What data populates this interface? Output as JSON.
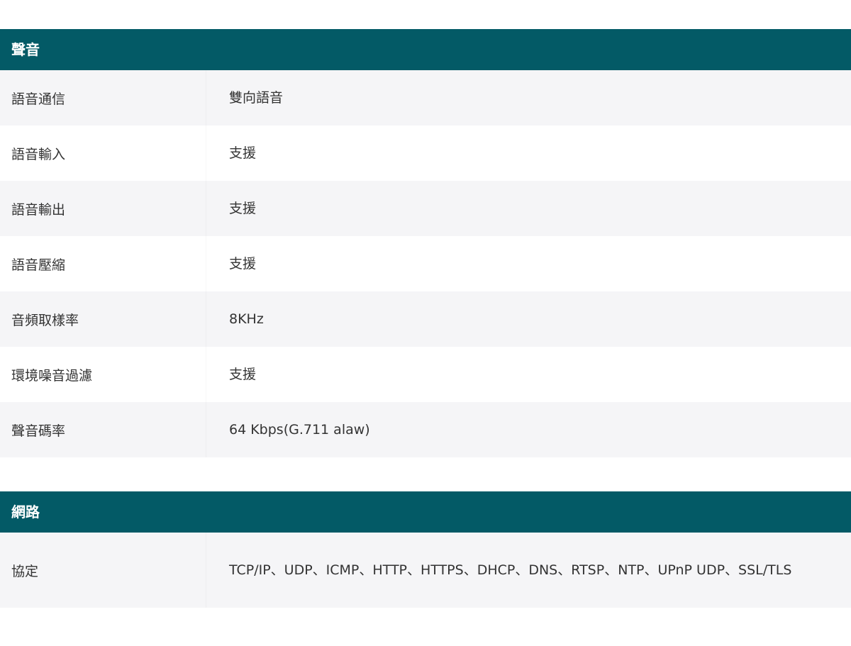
{
  "colors": {
    "header_bg": "#035a66",
    "header_text": "#ffffff",
    "row_alt_bg": "#f5f5f7",
    "text": "#333333"
  },
  "sections": [
    {
      "title": "聲音",
      "rows": [
        {
          "label": "語音通信",
          "value": "雙向語音"
        },
        {
          "label": "語音輸入",
          "value": "支援"
        },
        {
          "label": "語音輸出",
          "value": "支援"
        },
        {
          "label": "語音壓縮",
          "value": "支援"
        },
        {
          "label": "音頻取樣率",
          "value": "8KHz"
        },
        {
          "label": "環境噪音過濾",
          "value": "支援"
        },
        {
          "label": "聲音碼率",
          "value": "64 Kbps(G.711 alaw)"
        }
      ]
    },
    {
      "title": "網路",
      "rows": [
        {
          "label": "協定",
          "value": "TCP/IP、UDP、ICMP、HTTP、HTTPS、DHCP、DNS、RTSP、NTP、UPnP UDP、SSL/TLS"
        }
      ]
    }
  ]
}
